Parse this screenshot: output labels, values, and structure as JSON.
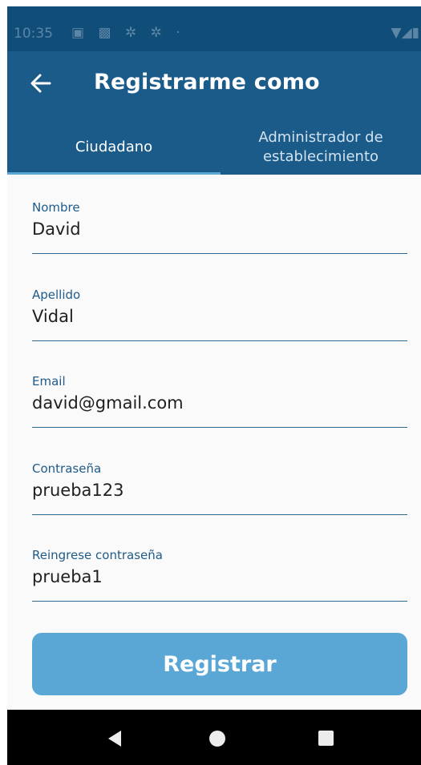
{
  "status_bar": {
    "time": "10:35",
    "icons": [
      "notification-icon",
      "image-icon",
      "settings-icon",
      "settings-icon",
      "dot-icon"
    ],
    "right_icons": [
      "wifi-icon",
      "signal-icon",
      "battery-icon"
    ]
  },
  "app_bar": {
    "title": "Registrarme como",
    "back_icon": "arrow-left-icon"
  },
  "tabs": [
    {
      "label": "Ciudadano",
      "selected": true
    },
    {
      "label": "Administrador de establecimiento",
      "selected": false
    }
  ],
  "form": {
    "fields": [
      {
        "label": "Nombre",
        "value": "David"
      },
      {
        "label": "Apellido",
        "value": "Vidal"
      },
      {
        "label": "Email",
        "value": "david@gmail.com"
      },
      {
        "label": "Contraseña",
        "value": "prueba123"
      },
      {
        "label": "Reingrese contraseña",
        "value": "prueba1"
      }
    ],
    "submit_label": "Registrar"
  },
  "nav_bar": {
    "buttons": [
      "back-icon",
      "home-icon",
      "recent-apps-icon"
    ]
  },
  "colors": {
    "primary": "#1a5b8a",
    "status_bar": "#114d79",
    "accent": "#5aa7d6",
    "label": "#1e5b8a"
  }
}
